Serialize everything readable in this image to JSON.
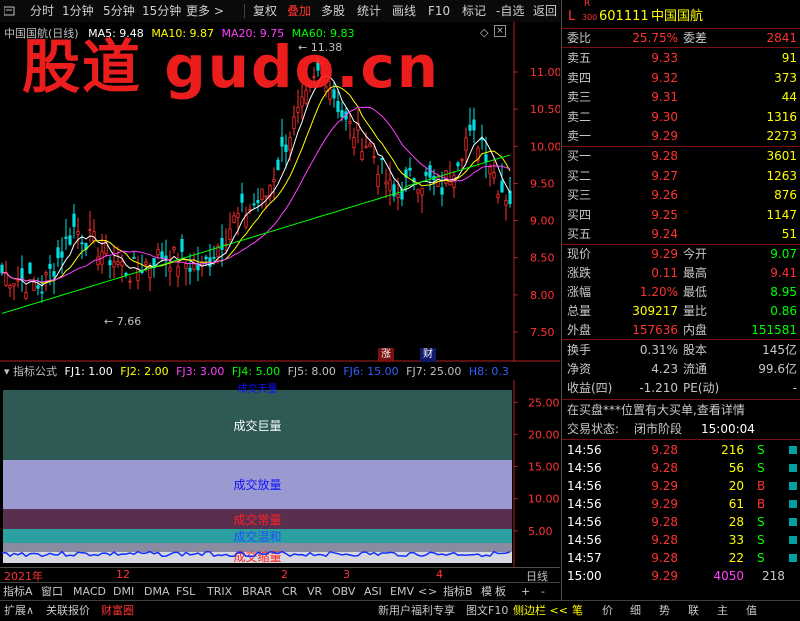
{
  "toolbar": {
    "items": [
      "分时",
      "1分钟",
      "5分钟",
      "15分钟",
      "更多 >",
      "复权",
      "叠加",
      "多股",
      "统计",
      "画线",
      "F10",
      "标记",
      "-自选",
      "返回"
    ],
    "active_index": 6
  },
  "chart": {
    "title": "中国国航(日线)",
    "ma": [
      {
        "label": "MA5: 9.48",
        "color": "#ffffff"
      },
      {
        "label": "MA10: 9.87",
        "color": "#ffff00"
      },
      {
        "label": "MA20: 9.75",
        "color": "#ff40ff"
      },
      {
        "label": "MA60: 9.83",
        "color": "#00ff00"
      }
    ],
    "high_label": "11.38",
    "low_label": "7.66",
    "badge_up": "涨",
    "badge_fin": "财",
    "watermark": "股道 gudo.cn"
  },
  "chart_data": {
    "type": "candlestick",
    "y_ticks": [
      "11.00",
      "10.50",
      "10.00",
      "9.50",
      "9.00",
      "8.50",
      "8.00",
      "7.50"
    ],
    "x_ticks": [
      "2021年",
      "12",
      "2",
      "3",
      "4"
    ],
    "indicator_ticks": [
      "25.00",
      "20.00",
      "15.00",
      "10.00",
      "5.00"
    ]
  },
  "indicator": {
    "header": "指标公式",
    "params": [
      {
        "label": "FJ1: 1.00",
        "color": "#ffffff"
      },
      {
        "label": "FJ2: 2.00",
        "color": "#ffff00"
      },
      {
        "label": "FJ3: 3.00",
        "color": "#ff40ff"
      },
      {
        "label": "FJ4: 5.00",
        "color": "#00ff00"
      },
      {
        "label": "FJ5: 8.00",
        "color": "#c0c0c0"
      },
      {
        "label": "FJ6: 15.00",
        "color": "#3060ff"
      },
      {
        "label": "FJ7: 25.00",
        "color": "#c0c0c0"
      },
      {
        "label": "H8: 0.3",
        "color": "#3060ff"
      }
    ],
    "bands": [
      {
        "label": "成交巨量",
        "color": "#2e5a55",
        "text": "#ffffff"
      },
      {
        "label": "成交放量",
        "color": "#9a9ad0",
        "text": "#1010ff"
      },
      {
        "label": "成交常量",
        "color": "#5a2e4e",
        "text": "#ff2020"
      },
      {
        "label": "成交温和",
        "color": "#2aa0a0",
        "text": "#2050ff"
      },
      {
        "label": "成交缩量",
        "color": "#d8d8e0",
        "text": "#ff2020"
      }
    ],
    "top_label": "成交天量"
  },
  "date_right": "日线",
  "tabs1": [
    "指标A",
    "窗口",
    "MACD",
    "DMI",
    "DMA",
    "FSL",
    "TRIX",
    "BRAR",
    "CR",
    "VR",
    "OBV",
    "ASI",
    "EMV",
    "<",
    ">",
    "指标B",
    "模",
    "板",
    "+",
    "-"
  ],
  "tabs2": [
    "扩展∧",
    "关联报价",
    "财富圈",
    "新用户福利专享",
    "图文F10",
    "侧边栏 <<",
    "笔",
    "价",
    "细",
    "势",
    "联",
    "主",
    "值"
  ],
  "quote": {
    "prefix": "L",
    "r_label": "R",
    "r_sub": "300",
    "code": "601111",
    "name": "中国国航",
    "weibi_label": "委比",
    "weibi": "25.75%",
    "weicha_label": "委差",
    "weicha": "2841",
    "asks": [
      {
        "label": "卖五",
        "price": "9.33",
        "vol": "91"
      },
      {
        "label": "卖四",
        "price": "9.32",
        "vol": "373"
      },
      {
        "label": "卖三",
        "price": "9.31",
        "vol": "44"
      },
      {
        "label": "卖二",
        "price": "9.30",
        "vol": "1316"
      },
      {
        "label": "卖一",
        "price": "9.29",
        "vol": "2273"
      }
    ],
    "bids": [
      {
        "label": "买一",
        "price": "9.28",
        "vol": "3601"
      },
      {
        "label": "买二",
        "price": "9.27",
        "vol": "1263"
      },
      {
        "label": "买三",
        "price": "9.26",
        "vol": "876"
      },
      {
        "label": "买四",
        "price": "9.25",
        "vol": "1147"
      },
      {
        "label": "买五",
        "price": "9.24",
        "vol": "51"
      }
    ],
    "stats": [
      {
        "l1": "现价",
        "v1": "9.29",
        "c1": "#ff3333",
        "l2": "今开",
        "v2": "9.07",
        "c2": "#00ff00"
      },
      {
        "l1": "涨跌",
        "v1": "0.11",
        "c1": "#ff3333",
        "l2": "最高",
        "v2": "9.41",
        "c2": "#ff3333"
      },
      {
        "l1": "涨幅",
        "v1": "1.20%",
        "c1": "#ff3333",
        "l2": "最低",
        "v2": "8.95",
        "c2": "#00ff00"
      },
      {
        "l1": "总量",
        "v1": "309217",
        "c1": "#ffff00",
        "l2": "量比",
        "v2": "0.86",
        "c2": "#00ff00"
      },
      {
        "l1": "外盘",
        "v1": "157636",
        "c1": "#ff3333",
        "l2": "内盘",
        "v2": "151581",
        "c2": "#00ff00"
      }
    ],
    "stats2": [
      {
        "l1": "换手",
        "v1": "0.31%",
        "l2": "股本",
        "v2": "145亿"
      },
      {
        "l1": "净资",
        "v1": "4.23",
        "l2": "流通",
        "v2": "99.6亿"
      },
      {
        "l1": "收益(四)",
        "v1": "-1.210",
        "l2": "PE(动)",
        "v2": "-"
      }
    ],
    "notice": "在买盘***位置有大买单,查看详情",
    "status_label": "交易状态:",
    "status_value": "闭市阶段",
    "status_time": "15:00:04",
    "ticks": [
      {
        "t": "14:56",
        "p": "9.28",
        "v": "216",
        "s": "S"
      },
      {
        "t": "14:56",
        "p": "9.28",
        "v": "56",
        "s": "S"
      },
      {
        "t": "14:56",
        "p": "9.29",
        "v": "20",
        "s": "B"
      },
      {
        "t": "14:56",
        "p": "9.29",
        "v": "61",
        "s": "B"
      },
      {
        "t": "14:56",
        "p": "9.28",
        "v": "28",
        "s": "S"
      },
      {
        "t": "14:56",
        "p": "9.28",
        "v": "33",
        "s": "S"
      },
      {
        "t": "14:57",
        "p": "9.28",
        "v": "22",
        "s": "S"
      },
      {
        "t": "15:00",
        "p": "9.29",
        "v": "4050",
        "s": "218"
      }
    ]
  }
}
